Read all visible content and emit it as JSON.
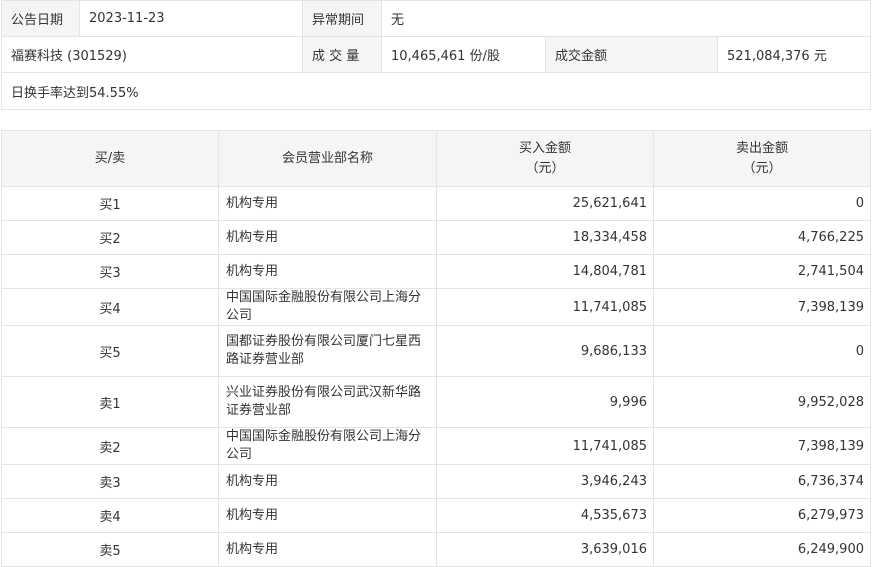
{
  "info": {
    "date_label": "公告日期",
    "date_value": "2023-11-23",
    "period_label": "异常期间",
    "period_value": "无",
    "stock": "福赛科技 (301529)",
    "volume_label": "成 交 量",
    "volume_value": "10,465,461 份/股",
    "amount_label": "成交金额",
    "amount_value": "521,084,376 元",
    "reason": "日换手率达到54.55%"
  },
  "table": {
    "headers": {
      "side": "买/卖",
      "dept": "会员营业部名称",
      "buy_line1": "买入金额",
      "buy_line2": "（元）",
      "sell_line1": "卖出金额",
      "sell_line2": "（元）"
    },
    "rows": [
      {
        "side": "买1",
        "dept": "机构专用",
        "buy": "25,621,641",
        "sell": "0"
      },
      {
        "side": "买2",
        "dept": "机构专用",
        "buy": "18,334,458",
        "sell": "4,766,225"
      },
      {
        "side": "买3",
        "dept": "机构专用",
        "buy": "14,804,781",
        "sell": "2,741,504"
      },
      {
        "side": "买4",
        "dept": "中国国际金融股份有限公司上海分公司",
        "buy": "11,741,085",
        "sell": "7,398,139"
      },
      {
        "side": "买5",
        "dept": "国都证券股份有限公司厦门七星西路证券营业部",
        "buy": "9,686,133",
        "sell": "0"
      },
      {
        "side": "卖1",
        "dept": "兴业证券股份有限公司武汉新华路证券营业部",
        "buy": "9,996",
        "sell": "9,952,028"
      },
      {
        "side": "卖2",
        "dept": "中国国际金融股份有限公司上海分公司",
        "buy": "11,741,085",
        "sell": "7,398,139"
      },
      {
        "side": "卖3",
        "dept": "机构专用",
        "buy": "3,946,243",
        "sell": "6,736,374"
      },
      {
        "side": "卖4",
        "dept": "机构专用",
        "buy": "4,535,673",
        "sell": "6,279,973"
      },
      {
        "side": "卖5",
        "dept": "机构专用",
        "buy": "3,639,016",
        "sell": "6,249,900"
      }
    ]
  }
}
